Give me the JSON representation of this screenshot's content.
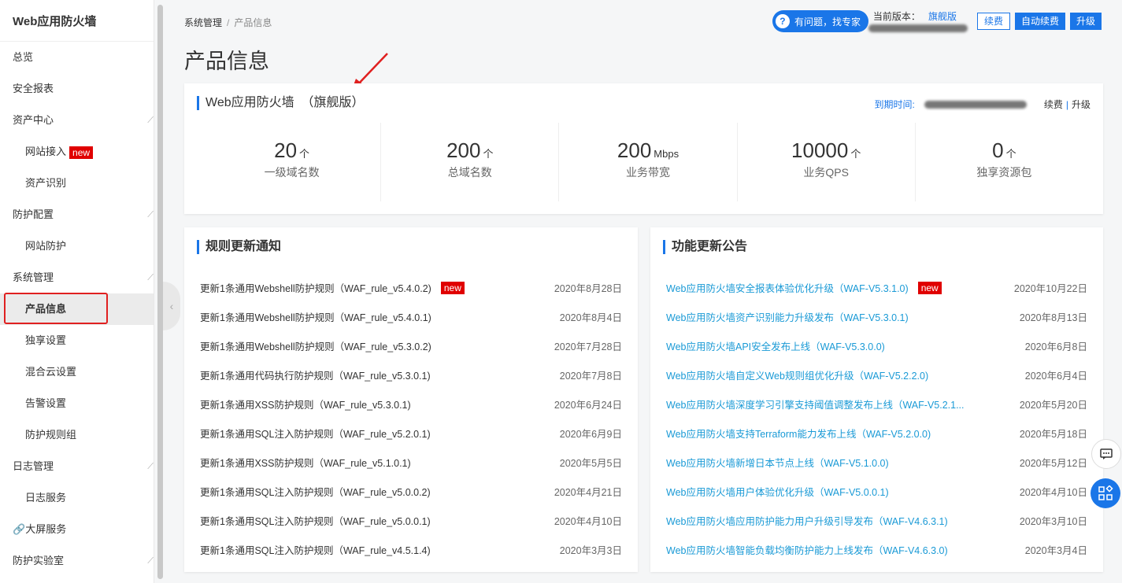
{
  "sidebar": {
    "title": "Web应用防火墙",
    "items": [
      {
        "label": "总览"
      },
      {
        "label": "安全报表"
      },
      {
        "label": "资产中心"
      },
      {
        "label": "网站接入",
        "badge": "new"
      },
      {
        "label": "资产识别"
      },
      {
        "label": "防护配置"
      },
      {
        "label": "网站防护"
      },
      {
        "label": "系统管理"
      },
      {
        "label": "产品信息"
      },
      {
        "label": "独享设置"
      },
      {
        "label": "混合云设置"
      },
      {
        "label": "告警设置"
      },
      {
        "label": "防护规则组"
      },
      {
        "label": "日志管理"
      },
      {
        "label": "日志服务"
      },
      {
        "label": "大屏服务"
      },
      {
        "label": "防护实验室"
      }
    ]
  },
  "breadcrumb": {
    "parent": "系统管理",
    "sep": "/",
    "current": "产品信息"
  },
  "page_title": "产品信息",
  "header": {
    "expert_label": "有问题，找专家",
    "version_label": "当前版本：",
    "version_value": "旗舰版",
    "renew_label": "续费",
    "auto_renew_label": "自动续费",
    "upgrade_label": "升级"
  },
  "product": {
    "title": "Web应用防火墙  （旗舰版）",
    "expire_label": "到期时间:",
    "renew_link": "续费",
    "divider": "|",
    "upgrade_link": "升级",
    "stats": [
      {
        "value": "20",
        "unit": "个",
        "label": "一级域名数"
      },
      {
        "value": "200",
        "unit": "个",
        "label": "总域名数"
      },
      {
        "value": "200",
        "unit": "Mbps",
        "label": "业务带宽"
      },
      {
        "value": "10000",
        "unit": "个",
        "label": "业务QPS"
      },
      {
        "value": "0",
        "unit": "个",
        "label": "独享资源包"
      }
    ]
  },
  "rules": {
    "title": "规则更新通知",
    "items": [
      {
        "text": "更新1条通用Webshell防护规则（WAF_rule_v5.4.0.2)",
        "badge": "new",
        "date": "2020年8月28日"
      },
      {
        "text": "更新1条通用Webshell防护规则（WAF_rule_v5.4.0.1)",
        "date": "2020年8月4日"
      },
      {
        "text": "更新1条通用Webshell防护规则（WAF_rule_v5.3.0.2)",
        "date": "2020年7月28日"
      },
      {
        "text": "更新1条通用代码执行防护规则（WAF_rule_v5.3.0.1)",
        "date": "2020年7月8日"
      },
      {
        "text": "更新1条通用XSS防护规则（WAF_rule_v5.3.0.1)",
        "date": "2020年6月24日"
      },
      {
        "text": "更新1条通用SQL注入防护规则（WAF_rule_v5.2.0.1)",
        "date": "2020年6月9日"
      },
      {
        "text": "更新1条通用XSS防护规则（WAF_rule_v5.1.0.1)",
        "date": "2020年5月5日"
      },
      {
        "text": "更新1条通用SQL注入防护规则（WAF_rule_v5.0.0.2)",
        "date": "2020年4月21日"
      },
      {
        "text": "更新1条通用SQL注入防护规则（WAF_rule_v5.0.0.1)",
        "date": "2020年4月10日"
      },
      {
        "text": "更新1条通用SQL注入防护规则（WAF_rule_v4.5.1.4)",
        "date": "2020年3月3日"
      }
    ]
  },
  "features": {
    "title": "功能更新公告",
    "items": [
      {
        "text": "Web应用防火墙安全报表体验优化升级（WAF-V5.3.1.0)",
        "badge": "new",
        "date": "2020年10月22日"
      },
      {
        "text": "Web应用防火墙资产识别能力升级发布（WAF-V5.3.0.1)",
        "date": "2020年8月13日"
      },
      {
        "text": "Web应用防火墙API安全发布上线（WAF-V5.3.0.0)",
        "date": "2020年6月8日"
      },
      {
        "text": "Web应用防火墙自定义Web规则组优化升级（WAF-V5.2.2.0)",
        "date": "2020年6月4日"
      },
      {
        "text": "Web应用防火墙深度学习引擎支持阈值调整发布上线（WAF-V5.2.1...",
        "date": "2020年5月20日"
      },
      {
        "text": "Web应用防火墙支持Terraform能力发布上线（WAF-V5.2.0.0)",
        "date": "2020年5月18日"
      },
      {
        "text": "Web应用防火墙新增日本节点上线（WAF-V5.1.0.0)",
        "date": "2020年5月12日"
      },
      {
        "text": "Web应用防火墙用户体验优化升级（WAF-V5.0.0.1)",
        "date": "2020年4月10日"
      },
      {
        "text": "Web应用防火墙应用防护能力用户升级引导发布（WAF-V4.6.3.1)",
        "date": "2020年3月10日"
      },
      {
        "text": "Web应用防火墙智能负载均衡防护能力上线发布（WAF-V4.6.3.0)",
        "date": "2020年3月4日"
      }
    ]
  },
  "colors": {
    "accent": "#1a76e8",
    "link": "#1a9ad6",
    "badge": "#e00000",
    "highlight": "#e02020"
  }
}
